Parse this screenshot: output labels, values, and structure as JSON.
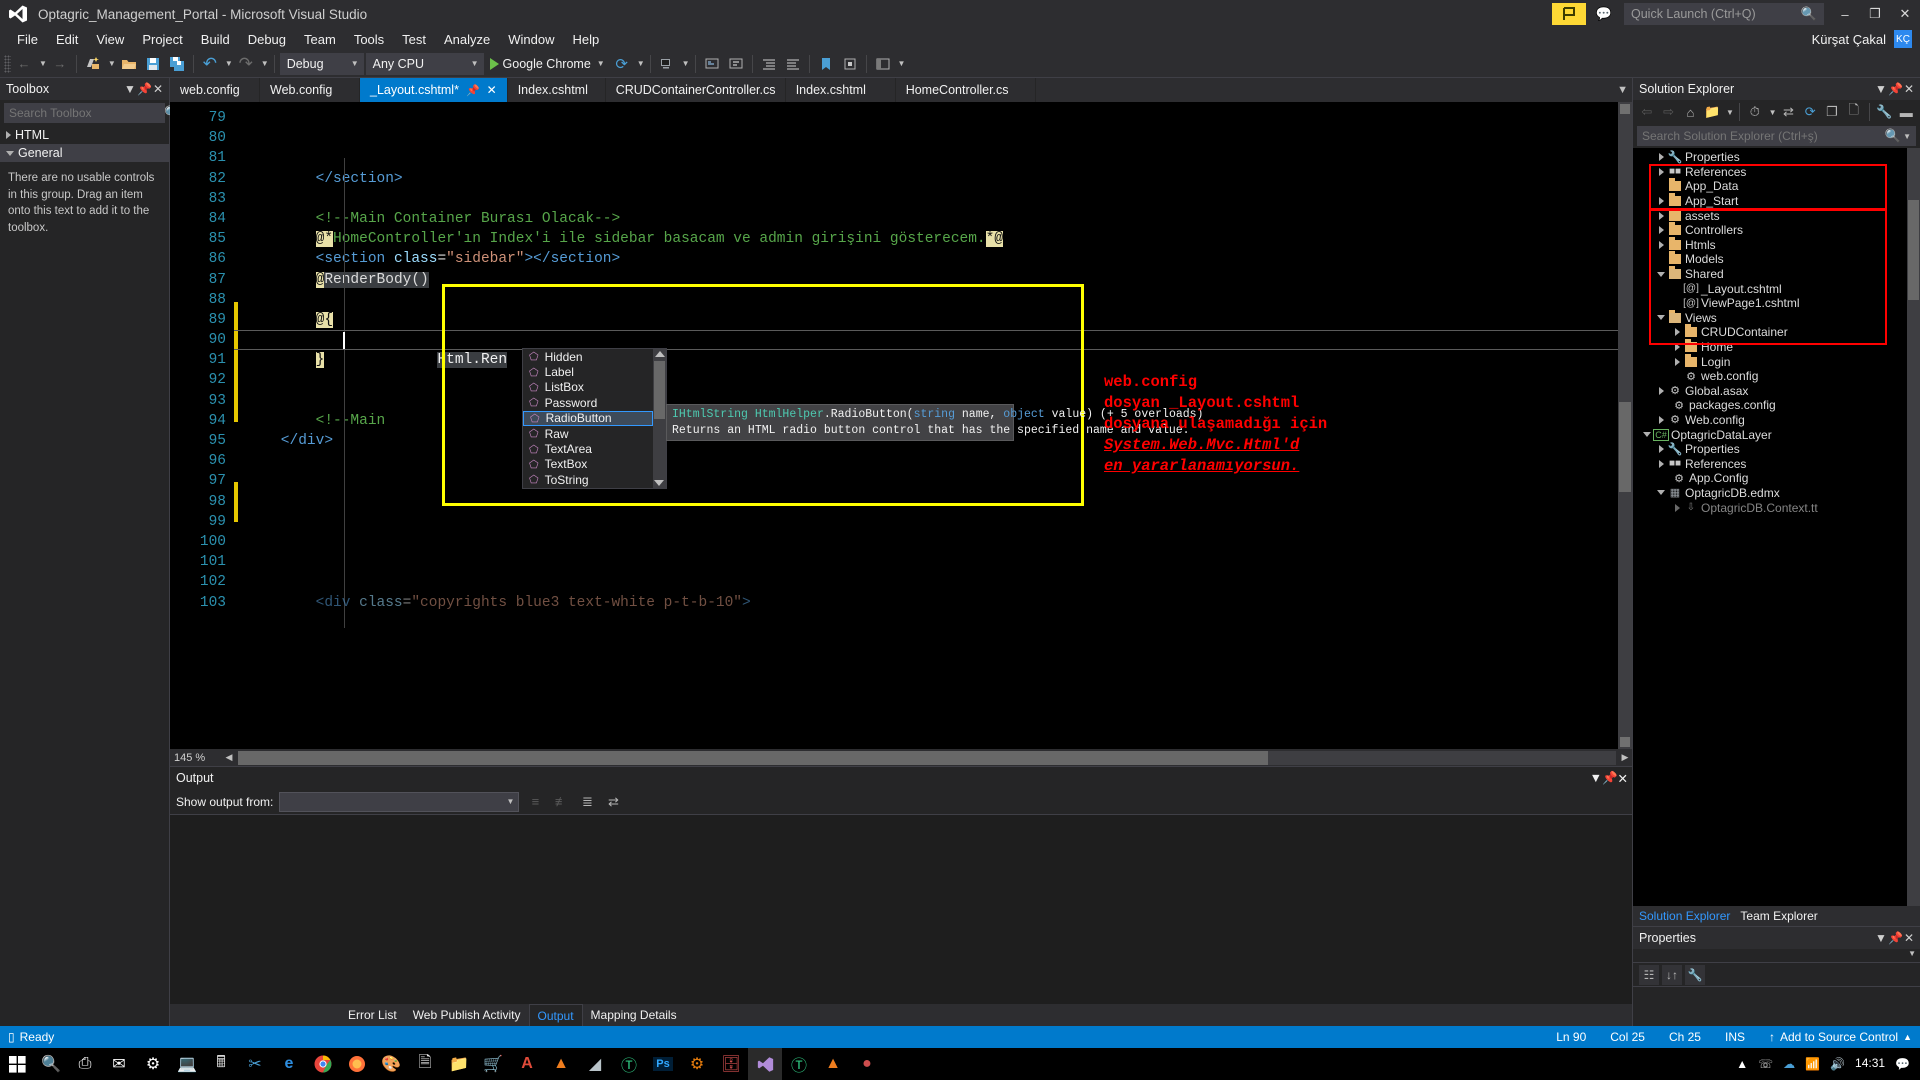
{
  "window": {
    "title": "Optagric_Management_Portal - Microsoft Visual Studio",
    "logo_icon": "visual-studio-logo",
    "quick_launch_placeholder": "Quick Launch (Ctrl+Q)",
    "minimize_label": "–",
    "maximize_label": "❐",
    "close_label": "✕",
    "user_name": "Kürşat Çakal",
    "user_initials": "KÇ"
  },
  "menu": {
    "items": [
      "File",
      "Edit",
      "View",
      "Project",
      "Build",
      "Debug",
      "Team",
      "Tools",
      "Test",
      "Analyze",
      "Window",
      "Help"
    ]
  },
  "toolbar": {
    "back_label": "←",
    "forward_label": "→",
    "new_item_label": "✦",
    "open_label": "📂",
    "save_label": "💾",
    "save_all_label": "🖫",
    "undo_label": "↶",
    "redo_label": "↷",
    "config_value": "Debug",
    "platform_value": "Any CPU",
    "run_target": "Google Chrome",
    "refresh_label": "↻"
  },
  "toolbox": {
    "title": "Toolbox",
    "search_placeholder": "Search Toolbox",
    "nodes": [
      {
        "label": "HTML",
        "expanded": false
      },
      {
        "label": "General",
        "expanded": true,
        "selected": true
      }
    ],
    "empty_message": "There are no usable controls in this group. Drag an item onto this text to add it to the toolbox."
  },
  "editor": {
    "tabs": [
      {
        "label": "web.config",
        "active": false,
        "dirty": false
      },
      {
        "label": "Web.config",
        "active": false,
        "dirty": false
      },
      {
        "label": "_Layout.cshtml*",
        "active": true,
        "dirty": true
      },
      {
        "label": "Index.cshtml",
        "active": false,
        "dirty": false
      },
      {
        "label": "CRUDContainerController.cs",
        "active": false,
        "dirty": false
      },
      {
        "label": "Index.cshtml",
        "active": false,
        "dirty": false
      },
      {
        "label": "HomeController.cs",
        "active": false,
        "dirty": false
      }
    ],
    "line_numbers": [
      79,
      80,
      81,
      82,
      83,
      84,
      85,
      86,
      87,
      88,
      89,
      90,
      91,
      92,
      93,
      94,
      95,
      96,
      97,
      98,
      99,
      100,
      101,
      102,
      103
    ],
    "lines": [
      {
        "n": 79,
        "text": ""
      },
      {
        "n": 80,
        "text": ""
      },
      {
        "n": 81,
        "text": ""
      },
      {
        "n": 82,
        "text": "        </section>"
      },
      {
        "n": 83,
        "text": ""
      },
      {
        "n": 84,
        "text": "        <!--Main Container Burası Olacak-->"
      },
      {
        "n": 85,
        "text": "        @*HomeController'ın Index'i ile sidebar basacam ve admin girişini gösterecem.*@"
      },
      {
        "n": 86,
        "text": "        <section class=\"sidebar\"></section>"
      },
      {
        "n": 87,
        "text": "        @RenderBody()"
      },
      {
        "n": 88,
        "text": ""
      },
      {
        "n": 89,
        "text": "        @{"
      },
      {
        "n": 90,
        "text": "            Html.Ren"
      },
      {
        "n": 91,
        "text": "        }"
      },
      {
        "n": 92,
        "text": ""
      },
      {
        "n": 93,
        "text": ""
      },
      {
        "n": 94,
        "text": "        <!--Main"
      },
      {
        "n": 95,
        "text": "    </div>"
      },
      {
        "n": 96,
        "text": ""
      },
      {
        "n": 97,
        "text": ""
      },
      {
        "n": 98,
        "text": ""
      },
      {
        "n": 99,
        "text": ""
      },
      {
        "n": 100,
        "text": ""
      },
      {
        "n": 101,
        "text": ""
      },
      {
        "n": 102,
        "text": ""
      },
      {
        "n": 103,
        "text": "        <div class=\"copyrights blue3 text-white p-t-b-10\">"
      }
    ],
    "zoom_level": "145 %",
    "typed_text": "Html.Ren"
  },
  "intellisense": {
    "items": [
      {
        "label": "Hidden",
        "icon": "method-icon",
        "selected": false
      },
      {
        "label": "Label",
        "icon": "method-icon",
        "selected": false
      },
      {
        "label": "ListBox",
        "icon": "method-icon",
        "selected": false
      },
      {
        "label": "Password",
        "icon": "method-icon",
        "selected": false
      },
      {
        "label": "RadioButton",
        "icon": "method-icon",
        "selected": true
      },
      {
        "label": "Raw",
        "icon": "method-icon",
        "selected": false
      },
      {
        "label": "TextArea",
        "icon": "method-icon",
        "selected": false
      },
      {
        "label": "TextBox",
        "icon": "method-icon",
        "selected": false
      },
      {
        "label": "ToString",
        "icon": "method-icon",
        "selected": false
      }
    ],
    "tooltip": {
      "return_type": "IHtmlString",
      "class_name": "HtmlHelper",
      "member": ".RadioButton(",
      "param1_type": "string",
      "param1_name": " name, ",
      "param2_type": "object",
      "param2_name": " value) (+ 5 overloads)",
      "description": "Returns an HTML radio button control that has the specified name and value."
    }
  },
  "annotation": {
    "lines": [
      {
        "text": "web.config",
        "style": "normal"
      },
      {
        "text": "dosyan _Layout.cshtml",
        "style": "normal"
      },
      {
        "text": "dosyana ulaşamadığı için",
        "style": "normal"
      },
      {
        "text": "System.Web.Mvc.Html'd",
        "style": "italic-underline"
      },
      {
        "text": "en yararlanamıyorsun.",
        "style": "italic-underline"
      }
    ],
    "color": "#ff0000",
    "highlight_color": "#ffff00"
  },
  "output": {
    "title": "Output",
    "show_output_from_label": "Show output from:",
    "show_output_from_value": "",
    "tabs": [
      {
        "label": "Error List",
        "active": false
      },
      {
        "label": "Web Publish Activity",
        "active": false
      },
      {
        "label": "Output",
        "active": true
      },
      {
        "label": "Mapping Details",
        "active": false
      }
    ]
  },
  "solution_explorer": {
    "title": "Solution Explorer",
    "search_placeholder": "Search Solution Explorer (Ctrl+ş)",
    "tabs": [
      {
        "label": "Solution Explorer",
        "active": true
      },
      {
        "label": "Team Explorer",
        "active": false
      }
    ],
    "tree": [
      {
        "label": "Properties",
        "indent": 1,
        "expander": "collapsed",
        "icon": "wrench-icon"
      },
      {
        "label": "References",
        "indent": 1,
        "expander": "collapsed",
        "icon": "references-icon"
      },
      {
        "label": "App_Data",
        "indent": 1,
        "expander": "none",
        "icon": "folder-icon"
      },
      {
        "label": "App_Start",
        "indent": 1,
        "expander": "collapsed",
        "icon": "folder-icon"
      },
      {
        "label": "assets",
        "indent": 1,
        "expander": "collapsed",
        "icon": "folder-icon"
      },
      {
        "label": "Controllers",
        "indent": 1,
        "expander": "collapsed",
        "icon": "folder-icon"
      },
      {
        "label": "Htmls",
        "indent": 1,
        "expander": "collapsed",
        "icon": "folder-icon"
      },
      {
        "label": "Models",
        "indent": 1,
        "expander": "none",
        "icon": "folder-icon"
      },
      {
        "label": "Shared",
        "indent": 1,
        "expander": "expanded",
        "icon": "folder-open-icon"
      },
      {
        "label": "_Layout.cshtml",
        "indent": 2,
        "expander": "none",
        "icon": "razor-icon"
      },
      {
        "label": "ViewPage1.cshtml",
        "indent": 2,
        "expander": "none",
        "icon": "razor-icon"
      },
      {
        "label": "Views",
        "indent": 1,
        "expander": "expanded",
        "icon": "folder-open-icon"
      },
      {
        "label": "CRUDContainer",
        "indent": 2,
        "expander": "collapsed",
        "icon": "folder-icon"
      },
      {
        "label": "Home",
        "indent": 2,
        "expander": "collapsed",
        "icon": "folder-icon"
      },
      {
        "label": "Login",
        "indent": 2,
        "expander": "collapsed",
        "icon": "folder-icon"
      },
      {
        "label": "web.config",
        "indent": 2,
        "expander": "none",
        "icon": "config-icon"
      },
      {
        "label": "Global.asax",
        "indent": 1,
        "expander": "collapsed",
        "icon": "asax-icon"
      },
      {
        "label": "packages.config",
        "indent": 1,
        "expander": "none",
        "icon": "config-icon"
      },
      {
        "label": "Web.config",
        "indent": 1,
        "expander": "collapsed",
        "icon": "config-icon"
      },
      {
        "label": "OptagricDataLayer",
        "indent": 0,
        "expander": "expanded",
        "icon": "csharp-project-icon"
      },
      {
        "label": "Properties",
        "indent": 1,
        "expander": "collapsed",
        "icon": "wrench-icon"
      },
      {
        "label": "References",
        "indent": 1,
        "expander": "collapsed",
        "icon": "references-icon"
      },
      {
        "label": "App.Config",
        "indent": 1,
        "expander": "none",
        "icon": "config-icon"
      },
      {
        "label": "OptagricDB.edmx",
        "indent": 1,
        "expander": "expanded",
        "icon": "edmx-icon"
      },
      {
        "label": "OptagricDB.Context.tt",
        "indent": 2,
        "expander": "collapsed",
        "icon": "tt-icon"
      }
    ]
  },
  "properties": {
    "title": "Properties"
  },
  "status_bar": {
    "state": "Ready",
    "line": "Ln 90",
    "column": "Col 25",
    "char": "Ch 25",
    "insert_mode": "INS",
    "source_control": "Add to Source Control"
  },
  "taskbar": {
    "items": [
      "start-icon",
      "search-icon",
      "task-view-icon",
      "mail-icon",
      "settings-icon",
      "remote-desktop-icon",
      "calculator-icon",
      "snip-icon",
      "edge-icon",
      "chrome-icon",
      "firefox-icon",
      "paint-icon",
      "notepad-icon",
      "explorer-icon",
      "store-icon",
      "acrobat-icon",
      "vlc-icon",
      "sublime-icon",
      "unity-icon",
      "photoshop-icon",
      "blender-icon",
      "dbtool-icon",
      "visual-studio-icon",
      "green-app-icon",
      "vlc2-icon",
      "recorder-icon"
    ],
    "clock_time": "14:31",
    "clock_date": ""
  }
}
